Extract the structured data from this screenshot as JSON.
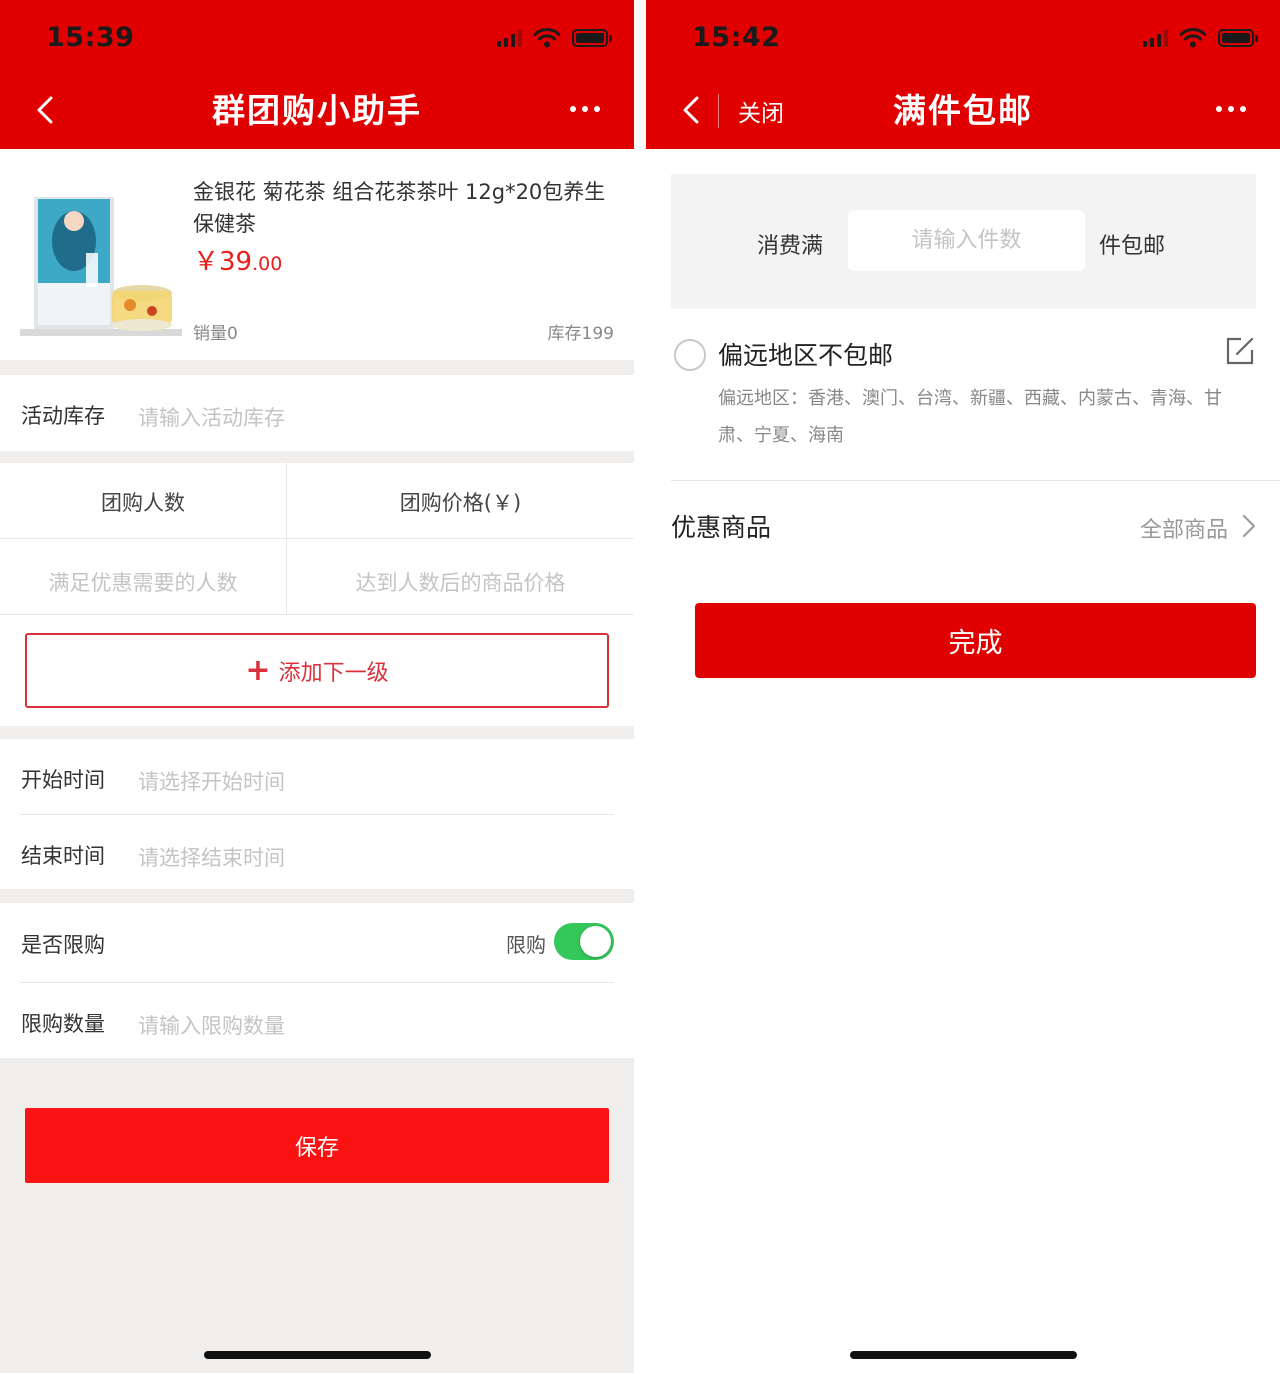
{
  "colors": {
    "brand_red": "#e10000",
    "button_red": "#fb1212",
    "price_red": "#e8201c",
    "toggle_green": "#34c759"
  },
  "left": {
    "status": {
      "time": "15:39"
    },
    "nav": {
      "title": "群团购小助手",
      "back_icon": "chevron-left-icon",
      "more_icon": "more-dots-icon"
    },
    "product": {
      "name": "金银花 菊花茶 组合花茶茶叶 12g*20包养生保健茶",
      "price_symbol": "￥",
      "price_int": "39",
      "price_cents": ".00",
      "sales": "销量0",
      "stock": "库存199"
    },
    "activity_stock": {
      "label": "活动库存",
      "placeholder": "请输入活动库存"
    },
    "tiers": {
      "header_count": "团购人数",
      "header_price": "团购价格(￥)",
      "count_placeholder": "满足优惠需要的人数",
      "price_placeholder": "达到人数后的商品价格"
    },
    "add_tier": {
      "plus": "+",
      "label": "添加下一级"
    },
    "start_time": {
      "label": "开始时间",
      "placeholder": "请选择开始时间"
    },
    "end_time": {
      "label": "结束时间",
      "placeholder": "请选择结束时间"
    },
    "limit": {
      "label": "是否限购",
      "toggle_label": "限购",
      "enabled": true
    },
    "limit_qty": {
      "label": "限购数量",
      "placeholder": "请输入限购数量"
    },
    "save": "保存"
  },
  "right": {
    "status": {
      "time": "15:42"
    },
    "nav": {
      "close": "关闭",
      "title": "满件包邮",
      "back_icon": "chevron-left-icon",
      "more_icon": "more-dots-icon"
    },
    "threshold": {
      "prefix": "消费满",
      "placeholder": "请输入件数",
      "suffix": "件包邮"
    },
    "remote": {
      "title": "偏远地区不包邮",
      "desc": "偏远地区：香港、澳门、台湾、新疆、西藏、内蒙古、青海、甘肃、宁夏、海南"
    },
    "promo": {
      "label": "优惠商品",
      "value": "全部商品"
    },
    "done": "完成"
  }
}
